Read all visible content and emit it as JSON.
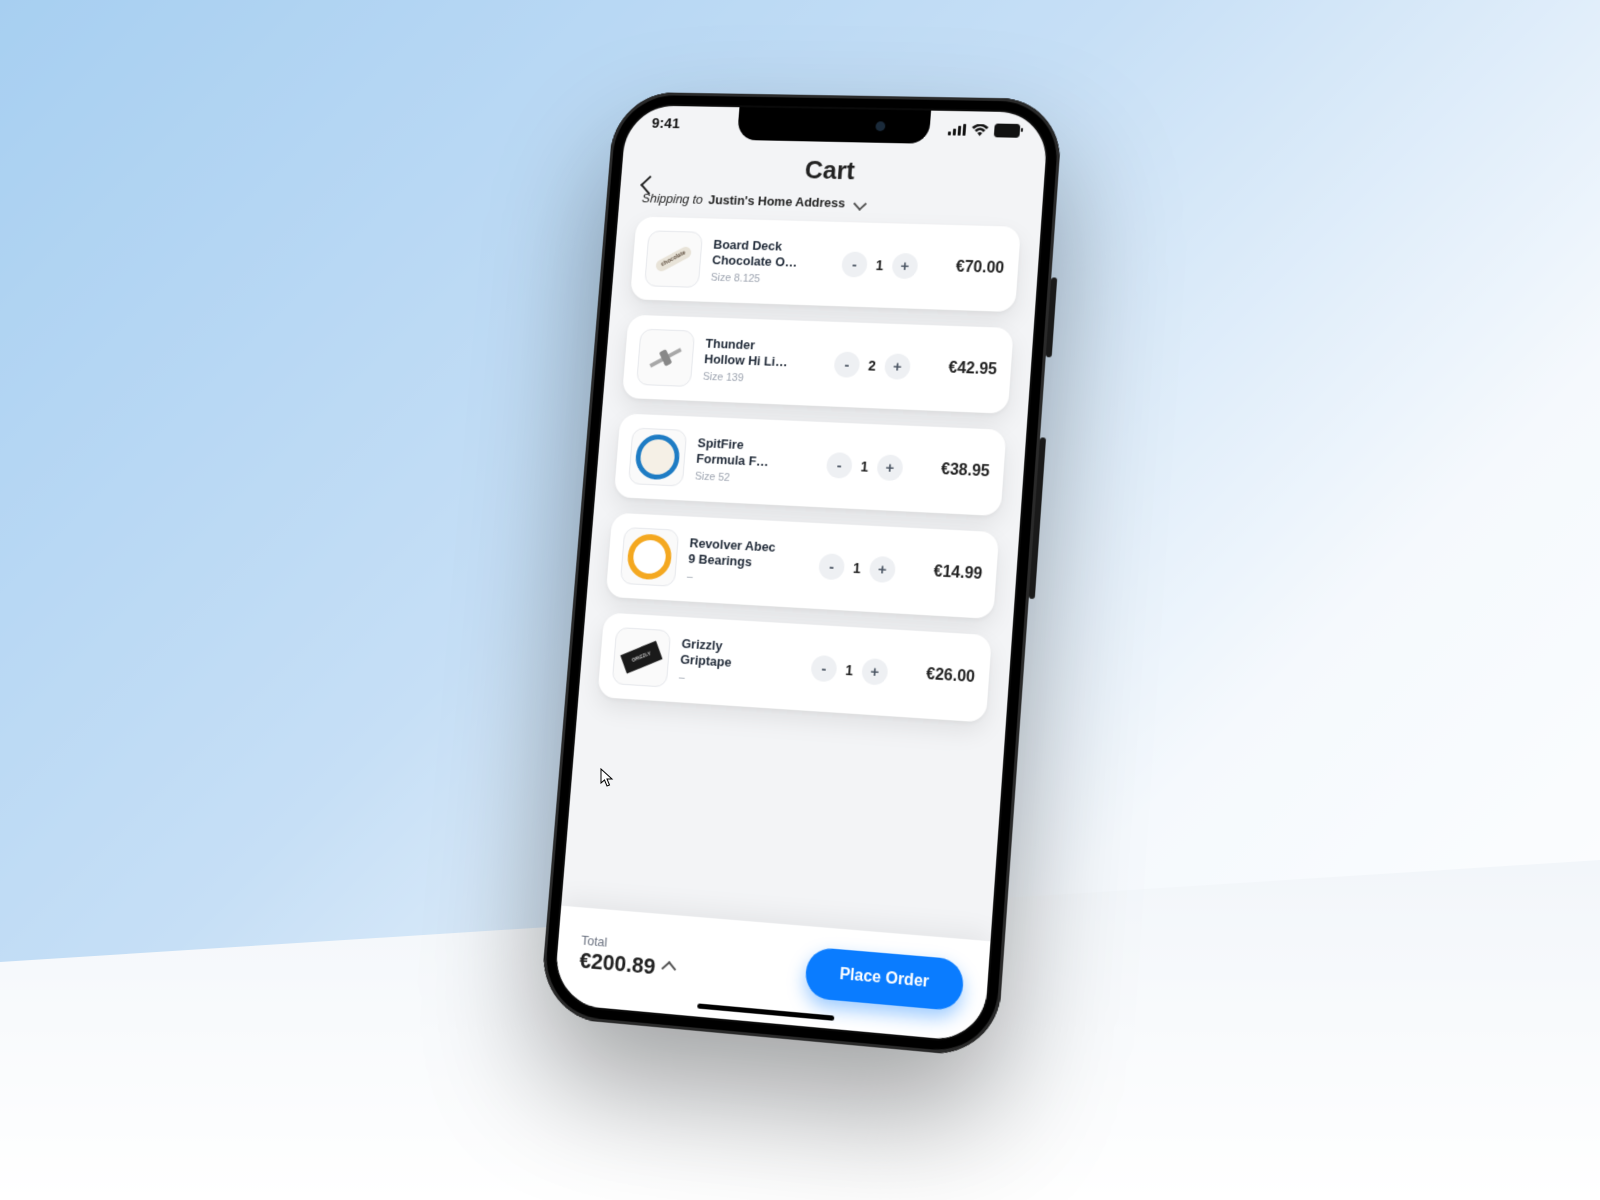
{
  "status_time": "9:41",
  "page_title": "Cart",
  "shipping_prefix": "Shipping to",
  "shipping_address": "Justin's Home Address",
  "items": [
    {
      "name": "Board Deck Chocolate O…",
      "size": "Size 8.125",
      "qty": "1",
      "price": "€70.00"
    },
    {
      "name": "Thunder Hollow Hi Li…",
      "size": "Size 139",
      "qty": "2",
      "price": "€42.95"
    },
    {
      "name": "SpitFire Formula F…",
      "size": "Size 52",
      "qty": "1",
      "price": "€38.95"
    },
    {
      "name": "Revolver Abec 9 Bearings",
      "size": "–",
      "qty": "1",
      "price": "€14.99"
    },
    {
      "name": "Grizzly Griptape",
      "size": "–",
      "qty": "1",
      "price": "€26.00"
    }
  ],
  "qty_minus": "-",
  "qty_plus": "+",
  "total_label": "Total",
  "total_value": "€200.89",
  "order_button": "Place Order"
}
